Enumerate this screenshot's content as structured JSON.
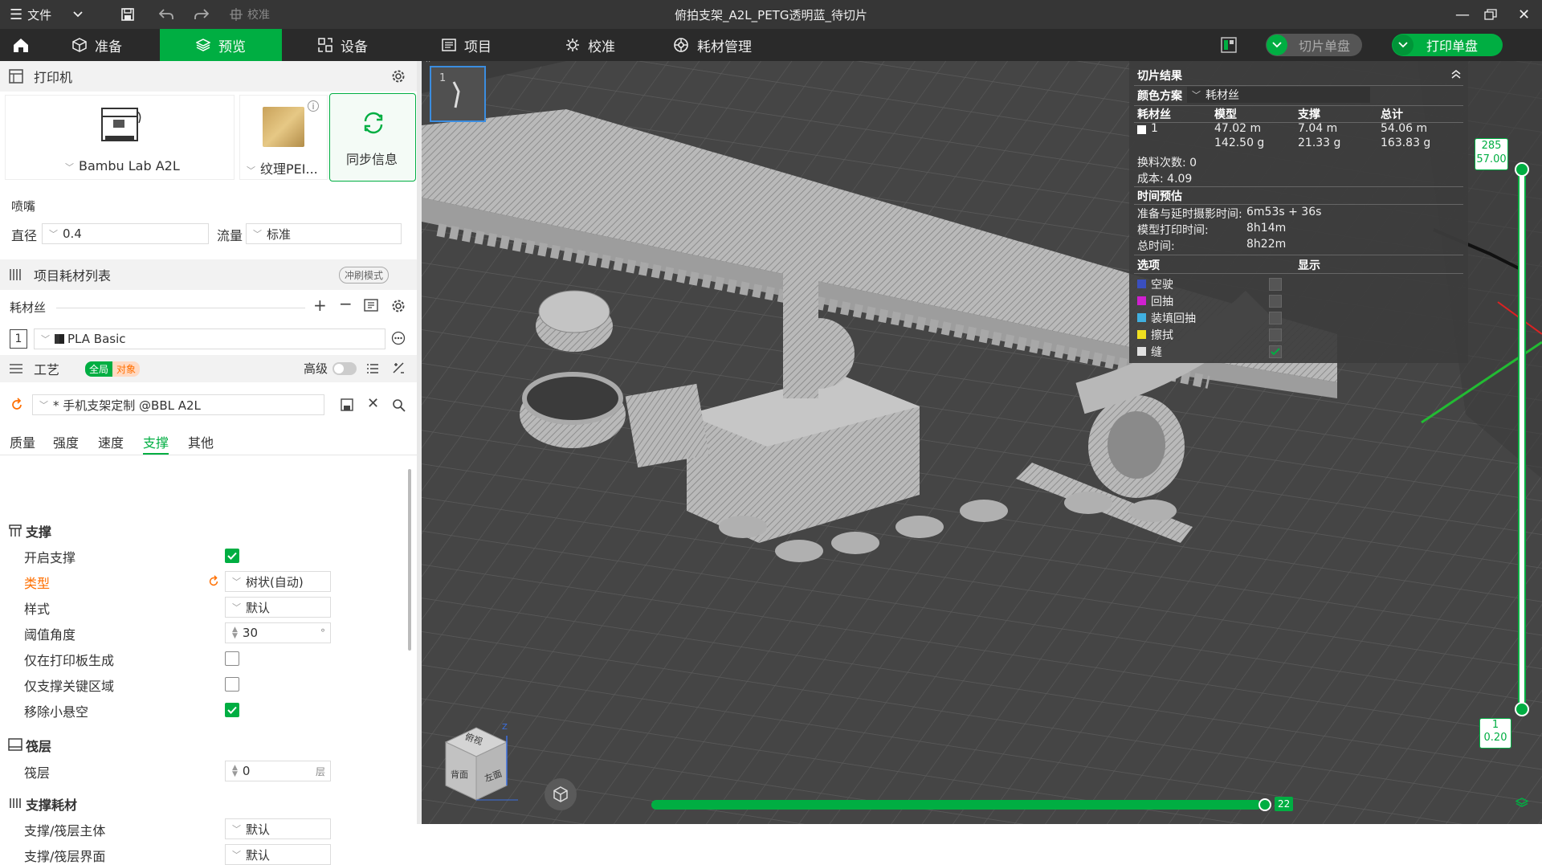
{
  "window": {
    "title": "俯拍支架_A2L_PETG透明蓝_待切片",
    "menu_file": "文件",
    "calibrate_dim": "校准"
  },
  "nav": {
    "tabs": [
      {
        "label": "准备",
        "icon": "cube-icon"
      },
      {
        "label": "预览",
        "icon": "layers-icon",
        "active": true
      },
      {
        "label": "设备",
        "icon": "device-icon"
      },
      {
        "label": "项目",
        "icon": "project-icon"
      },
      {
        "label": "校准",
        "icon": "calibrate-icon"
      },
      {
        "label": "耗材管理",
        "icon": "filament-icon"
      }
    ],
    "slice_button": "切片单盘",
    "print_button": "打印单盘"
  },
  "printer": {
    "section_title": "打印机",
    "printer_name": "Bambu Lab A2L",
    "plate_name": "纹理PEI...",
    "sync_label": "同步信息",
    "nozzle_title": "喷嘴",
    "diameter_label": "直径",
    "diameter_value": "0.4",
    "flow_label": "流量",
    "flow_value": "标准"
  },
  "filament": {
    "section_title": "项目耗材列表",
    "flush_mode": "冲刷模式",
    "sub_label": "耗材丝",
    "slot_number": "1",
    "filament_name": "PLA Basic"
  },
  "process": {
    "section_title": "工艺",
    "badge_global": "全局",
    "badge_object": "对象",
    "advanced_label": "高级",
    "preset_name": "* 手机支架定制 @BBL A2L",
    "tabs": [
      "质量",
      "强度",
      "速度",
      "支撑",
      "其他"
    ],
    "active_tab": "支撑",
    "support_group": "支撑",
    "settings": {
      "enable_support": "开启支撑",
      "type_label": "类型",
      "type_value": "树状(自动)",
      "style_label": "样式",
      "style_value": "默认",
      "threshold_label": "阈值角度",
      "threshold_value": "30",
      "threshold_unit": "°",
      "on_build_plate_label": "仅在打印板生成",
      "critical_only_label": "仅支撑关键区域",
      "remove_small_label": "移除小悬空"
    },
    "raft_group": "筏层",
    "raft_layers_label": "筏层",
    "raft_layers_value": "0",
    "raft_layers_unit": "层",
    "support_filament_group": "支撑耗材",
    "support_base_label": "支撑/筏层主体",
    "support_base_value": "默认",
    "support_interface_label": "支撑/筏层界面",
    "support_interface_value": "默认"
  },
  "slice_result": {
    "title": "切片结果",
    "color_scheme_label": "颜色方案",
    "color_scheme_value": "耗材丝",
    "columns": [
      "耗材丝",
      "模型",
      "支撑",
      "总计"
    ],
    "filament_row": {
      "id": "1",
      "model_length": "47.02 m",
      "model_weight": "142.50 g",
      "support_length": "7.04 m",
      "support_weight": "21.33 g",
      "total_length": "54.06 m",
      "total_weight": "163.83 g"
    },
    "change_count": "换料次数: 0",
    "cost": "成本: 4.09",
    "time_title": "时间预估",
    "prepare_label": "准备与延时摄影时间:",
    "prepare_value": "6m53s + 36s",
    "model_time_label": "模型打印时间:",
    "model_time_value": "8h14m",
    "total_time_label": "总时间:",
    "total_time_value": "8h22m",
    "options_label": "选项",
    "display_label": "显示",
    "options": [
      {
        "label": "空驶",
        "color": "#3a4fbf",
        "shown": false
      },
      {
        "label": "回抽",
        "color": "#d020d0",
        "shown": false
      },
      {
        "label": "装填回抽",
        "color": "#40b0e0",
        "shown": false
      },
      {
        "label": "擦拭",
        "color": "#f0e020",
        "shown": false
      },
      {
        "label": "缝",
        "color": "#e0e0e0",
        "shown": true
      }
    ]
  },
  "layer_slider": {
    "top_layer": "285",
    "top_height": "57.00",
    "bottom_layer": "1",
    "bottom_height": "0.20",
    "horizontal_value": "22"
  },
  "view_cube": {
    "face_top": "俯视",
    "face_left": "左面",
    "face_back": "背面",
    "axis_z": "Z"
  },
  "plate_thumb": {
    "number": "1"
  },
  "colors": {
    "accent": "#00ae42",
    "titlebar": "#363636",
    "navbar": "#2a2a2a",
    "viewport_bg": "#3b3b3b"
  }
}
